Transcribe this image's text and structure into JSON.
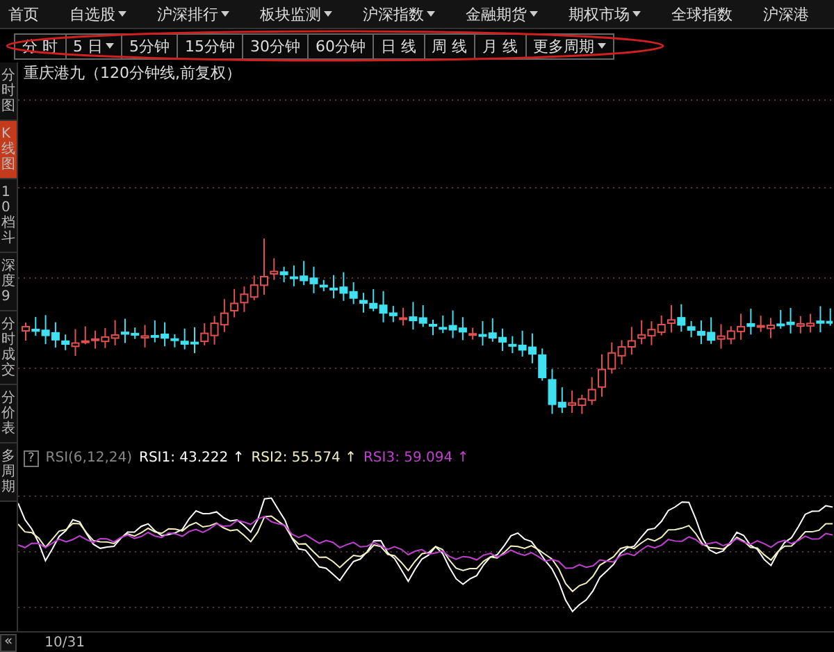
{
  "menu": [
    {
      "label": "首页",
      "dropdown": false
    },
    {
      "label": "自选股",
      "dropdown": true
    },
    {
      "label": "沪深排行",
      "dropdown": true
    },
    {
      "label": "板块监测",
      "dropdown": true
    },
    {
      "label": "沪深指数",
      "dropdown": true
    },
    {
      "label": "金融期货",
      "dropdown": true
    },
    {
      "label": "期权市场",
      "dropdown": true
    },
    {
      "label": "全球指数",
      "dropdown": false
    },
    {
      "label": "沪深港",
      "dropdown": false
    }
  ],
  "periods": [
    {
      "label": "分 时",
      "dropdown": false
    },
    {
      "label": "5 日",
      "dropdown": true
    },
    {
      "label": "5分钟",
      "dropdown": false
    },
    {
      "label": "15分钟",
      "dropdown": false
    },
    {
      "label": "30分钟",
      "dropdown": false
    },
    {
      "label": "60分钟",
      "dropdown": false
    },
    {
      "label": "日 线",
      "dropdown": false
    },
    {
      "label": "周 线",
      "dropdown": false
    },
    {
      "label": "月 线",
      "dropdown": false
    },
    {
      "label": "更多周期",
      "dropdown": true
    }
  ],
  "sidebar": [
    {
      "label": "分时图",
      "selected": false
    },
    {
      "label": "K线图",
      "selected": true
    },
    {
      "label": "10档斗",
      "selected": false
    },
    {
      "label": "深度9",
      "selected": false
    },
    {
      "label": "分时成交",
      "selected": false
    },
    {
      "label": "分价表",
      "selected": false
    },
    {
      "label": "多周期",
      "selected": false
    }
  ],
  "chart_title": "重庆港九（120分钟线,前复权）",
  "indicator": {
    "help": "?",
    "name": "RSI(6,12,24)",
    "lines": [
      {
        "label": "RSI1: 43.222",
        "arrow": "↑",
        "color": "#ffffff"
      },
      {
        "label": "RSI2: 55.574",
        "arrow": "↑",
        "color": "#f2f0c0"
      },
      {
        "label": "RSI3: 59.094",
        "arrow": "↑",
        "color": "#c040d0"
      }
    ]
  },
  "bottom": {
    "scroll_button": "«",
    "date": "10/31"
  }
}
